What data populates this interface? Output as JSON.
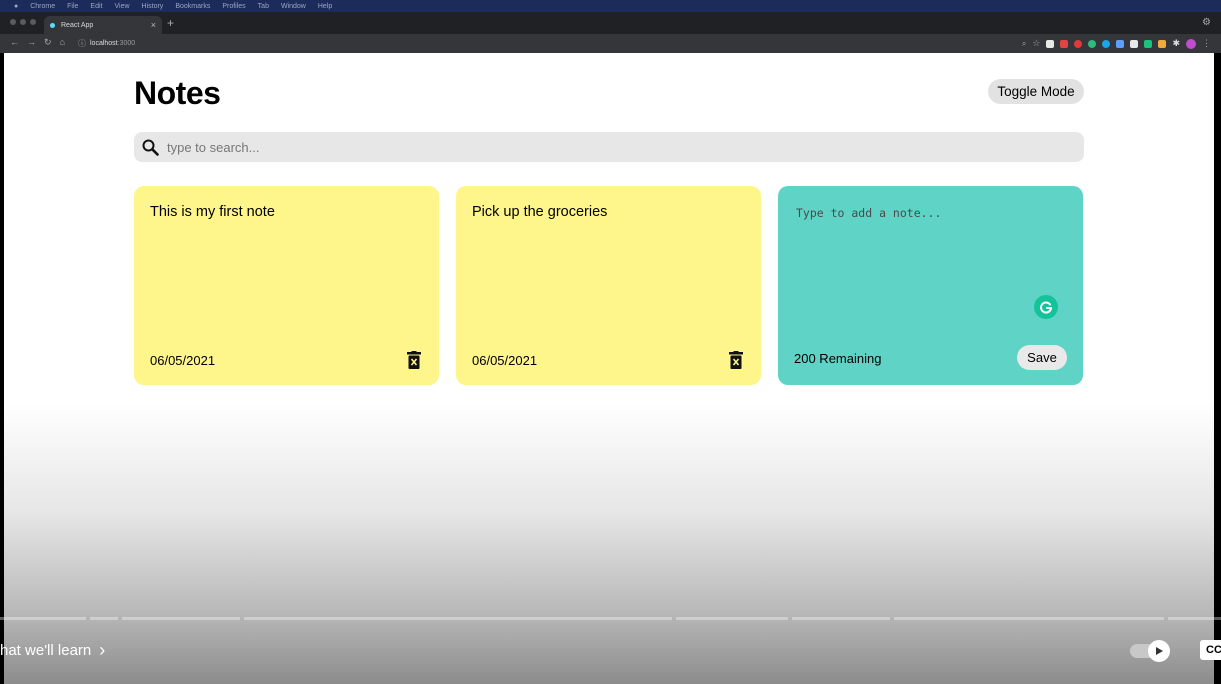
{
  "browser": {
    "menubar": [
      "Chrome",
      "File",
      "Edit",
      "View",
      "History",
      "Bookmarks",
      "Profiles",
      "Tab",
      "Window",
      "Help"
    ],
    "tab_title": "React App",
    "url_host": "localhost",
    "url_port": ":3000",
    "extension_colors": [
      "#e8e8e8",
      "#e24444",
      "#e23a3a",
      "#2dbb7e",
      "#1aa6e8",
      "#5ea0ff",
      "#e8e8e8",
      "#19c37d",
      "#f2a93b",
      "#f0f0f0",
      "#c04ccf"
    ]
  },
  "app": {
    "title": "Notes",
    "toggle_label": "Toggle Mode",
    "search_placeholder": "type to search...",
    "notes": [
      {
        "text": "This is my first note",
        "date": "06/05/2021"
      },
      {
        "text": "Pick up the groceries",
        "date": "06/05/2021"
      }
    ],
    "new_note": {
      "placeholder": "Type to add a note...",
      "remaining": "200 Remaining",
      "save_label": "Save"
    }
  },
  "player": {
    "chapter": "hat we'll learn",
    "cc": "CC"
  },
  "colors": {
    "note_yellow": "#fef68a",
    "new_note_teal": "#5fd3c5",
    "search_bg": "#e7e7e7",
    "grammarly_green": "#15c39a"
  }
}
